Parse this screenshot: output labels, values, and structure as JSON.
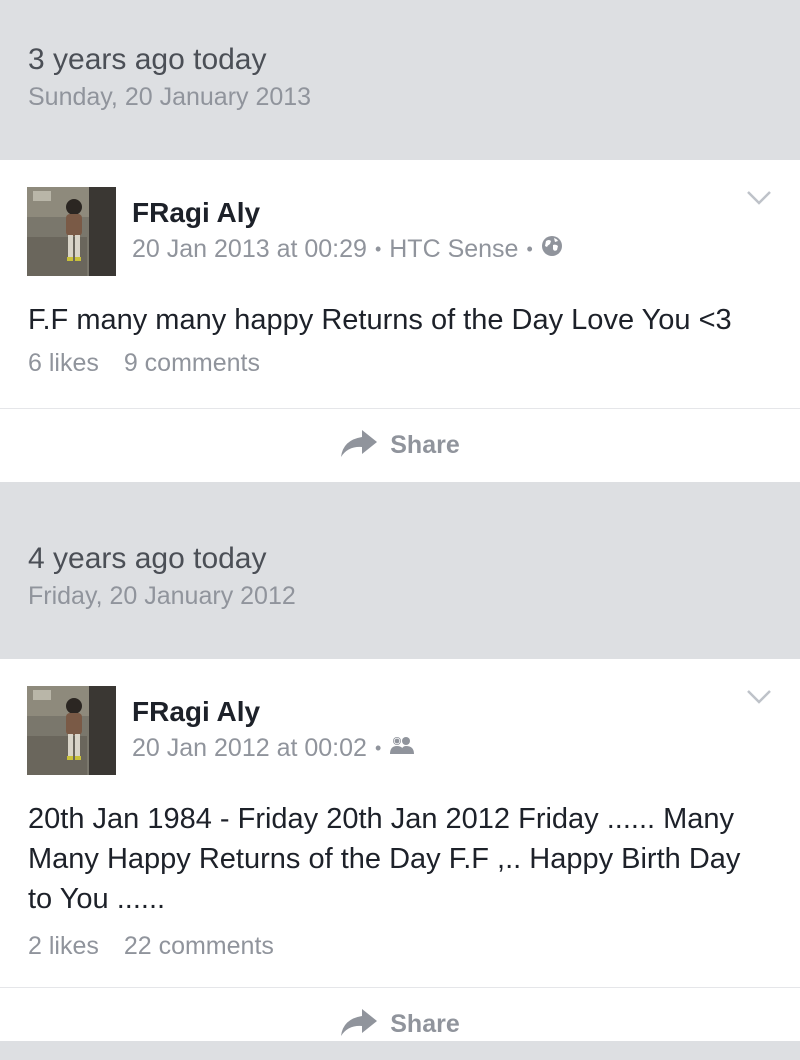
{
  "memories": [
    {
      "years_ago": "3 years ago today",
      "date": "Sunday, 20 January 2013",
      "post": {
        "author": "FRagi Aly",
        "timestamp": "20 Jan 2013 at 00:29",
        "source": "HTC Sense",
        "separator": "•",
        "privacy_icon": "globe-icon",
        "text": "F.F many many happy Returns of the Day Love You <3",
        "likes": "6 likes",
        "comments": "9 comments",
        "share_label": "Share"
      }
    },
    {
      "years_ago": "4 years ago today",
      "date": "Friday, 20 January 2012",
      "post": {
        "author": "FRagi Aly",
        "timestamp": "20 Jan 2012 at 00:02",
        "separator": "•",
        "privacy_icon": "friends-icon",
        "text": "20th Jan 1984 - Friday 20th Jan 2012 Friday ...... Many Many Happy Returns of the Day F.F ,.. Happy Birth Day to You ......",
        "likes": "2 likes",
        "comments": "22 comments",
        "share_label": "Share"
      }
    }
  ],
  "colors": {
    "background": "#dddfe2",
    "card": "#ffffff",
    "primary_text": "#1d2129",
    "secondary_text": "#90949c"
  }
}
